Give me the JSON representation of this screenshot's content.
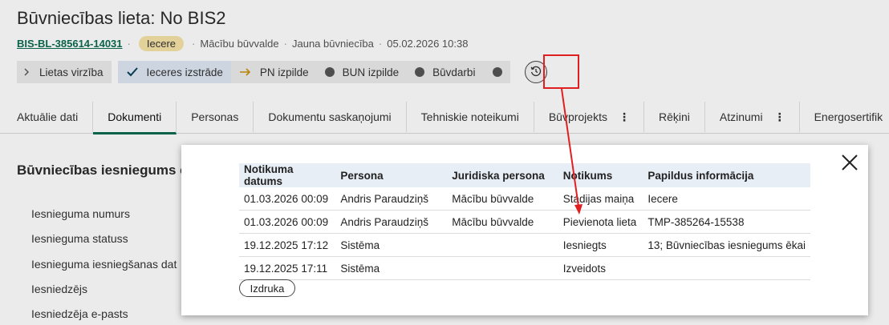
{
  "header": {
    "title": "Būvniecības lieta: No BIS2",
    "case_number": "BIS-BL-385614-14031",
    "separator": "·",
    "status_badge": "Iecere",
    "authority": "Mācību būvvalde",
    "case_type": "Jauna būvniecība",
    "datetime": "05.02.2026 10:38"
  },
  "stages": {
    "toggle_label": "Lietas virzība",
    "items": [
      {
        "label": "Ieceres izstrāde"
      },
      {
        "label": "PN izpilde"
      },
      {
        "label": "BUN izpilde"
      },
      {
        "label": "Būvdarbi"
      }
    ]
  },
  "tabs": [
    {
      "label": "Aktuālie dati"
    },
    {
      "label": "Dokumenti"
    },
    {
      "label": "Personas"
    },
    {
      "label": "Dokumentu saskaņojumi"
    },
    {
      "label": "Tehniskie noteikumi"
    },
    {
      "label": "Būvprojekts"
    },
    {
      "label": "Rēķini"
    },
    {
      "label": "Atzinumi"
    },
    {
      "label": "Energosertifik"
    }
  ],
  "kebab_glyph": "⋮",
  "section": {
    "title": "Būvniecības iesniegums ē",
    "fields": [
      "Iesnieguma numurs",
      "Iesnieguma statuss",
      "Iesnieguma iesniegšanas dat",
      "Iesniedzējs",
      "Iesniedzēja e-pasts"
    ]
  },
  "modal": {
    "columns": [
      "Notikuma datums",
      "Persona",
      "Juridiska persona",
      "Notikums",
      "Papildus informācija"
    ],
    "rows": [
      [
        "01.03.2026 00:09",
        "Andris Paraudziņš",
        "Mācību būvvalde",
        "Stadijas maiņa",
        "Iecere"
      ],
      [
        "01.03.2026 00:09",
        "Andris Paraudziņš",
        "Mācību būvvalde",
        "Pievienota lieta",
        "TMP-385264-15538"
      ],
      [
        "19.12.2025 17:12",
        "Sistēma",
        "",
        "Iesniegts",
        "13; Būvniecības iesniegums ēkai"
      ],
      [
        "19.12.2025 17:11",
        "Sistēma",
        "",
        "Izveidots",
        ""
      ]
    ],
    "print_label": "Izdruka"
  },
  "colors": {
    "accent": "#0b6b4f",
    "badge": "#f6e3a6",
    "annotation_red": "#e02020"
  }
}
